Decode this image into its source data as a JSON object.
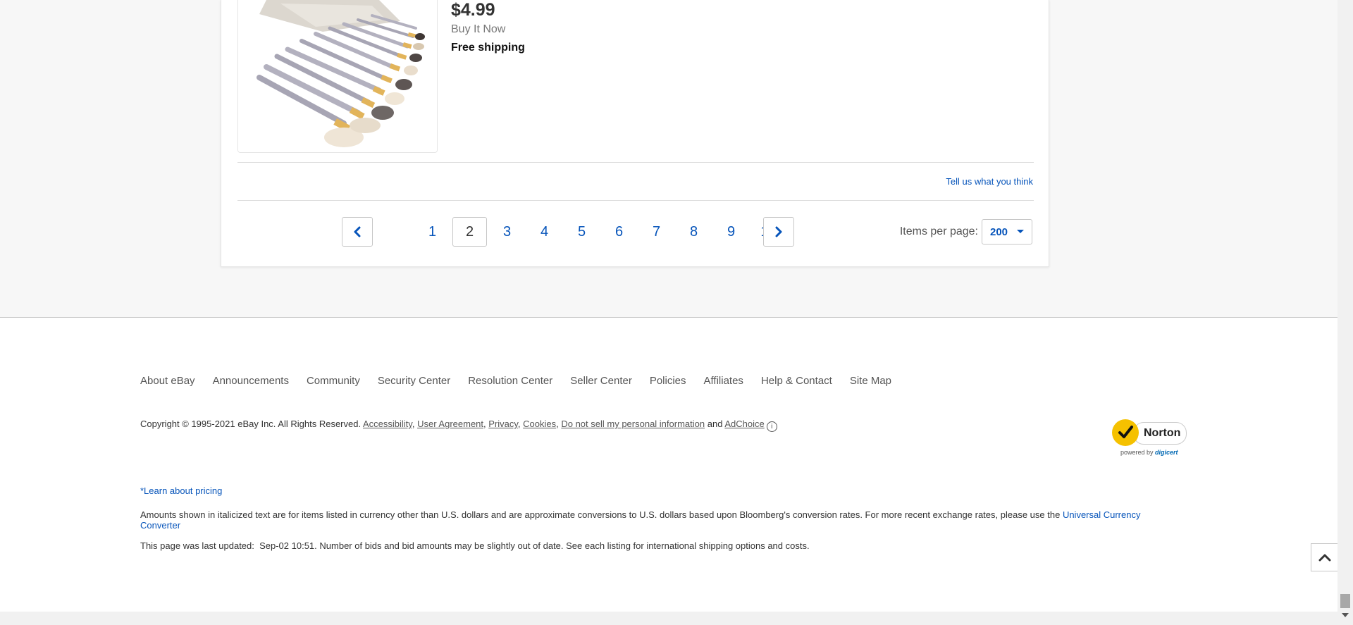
{
  "listing": {
    "price": "$4.99",
    "format": "Buy It Now",
    "shipping": "Free shipping",
    "image_icon": "makeup-brush-set-image"
  },
  "feedback": {
    "label": "Tell us what you think"
  },
  "pagination": {
    "pages": [
      "1",
      "2",
      "3",
      "4",
      "5",
      "6",
      "7",
      "8",
      "9",
      "10"
    ],
    "current_page": "2",
    "prev_icon": "chevron-left-icon",
    "next_icon": "chevron-right-icon",
    "items_per_page_label": "Items per page:",
    "items_per_page_value": "200"
  },
  "footer": {
    "nav": [
      "About eBay",
      "Announcements",
      "Community",
      "Security Center",
      "Resolution Center",
      "Seller Center",
      "Policies",
      "Affiliates",
      "Help & Contact",
      "Site Map"
    ],
    "copyright_text": "Copyright © 1995-2021 eBay Inc. All Rights Reserved.",
    "legal_links": [
      "Accessibility",
      "User Agreement",
      "Privacy",
      "Cookies",
      "Do not sell my personal information"
    ],
    "and_text": "and",
    "adchoice": "AdChoice",
    "norton_brand": "Norton",
    "norton_powered": "powered by",
    "norton_digicert": "digicert",
    "learn_pricing": "*Learn about pricing",
    "disclaimer_text": "Amounts shown in italicized text are for items listed in currency other than U.S. dollars and are approximate conversions to U.S. dollars based upon Bloomberg's conversion rates. For more recent exchange rates, please use the",
    "disclaimer_link": "Universal Currency Converter",
    "last_updated": "This page was last updated:  Sep-02 10:51. Number of bids and bid amounts may be slightly out of date. See each listing for international shipping options and costs."
  },
  "colors": {
    "link": "#0654ba",
    "price": "#333333",
    "norton_yellow": "#f5c100"
  }
}
